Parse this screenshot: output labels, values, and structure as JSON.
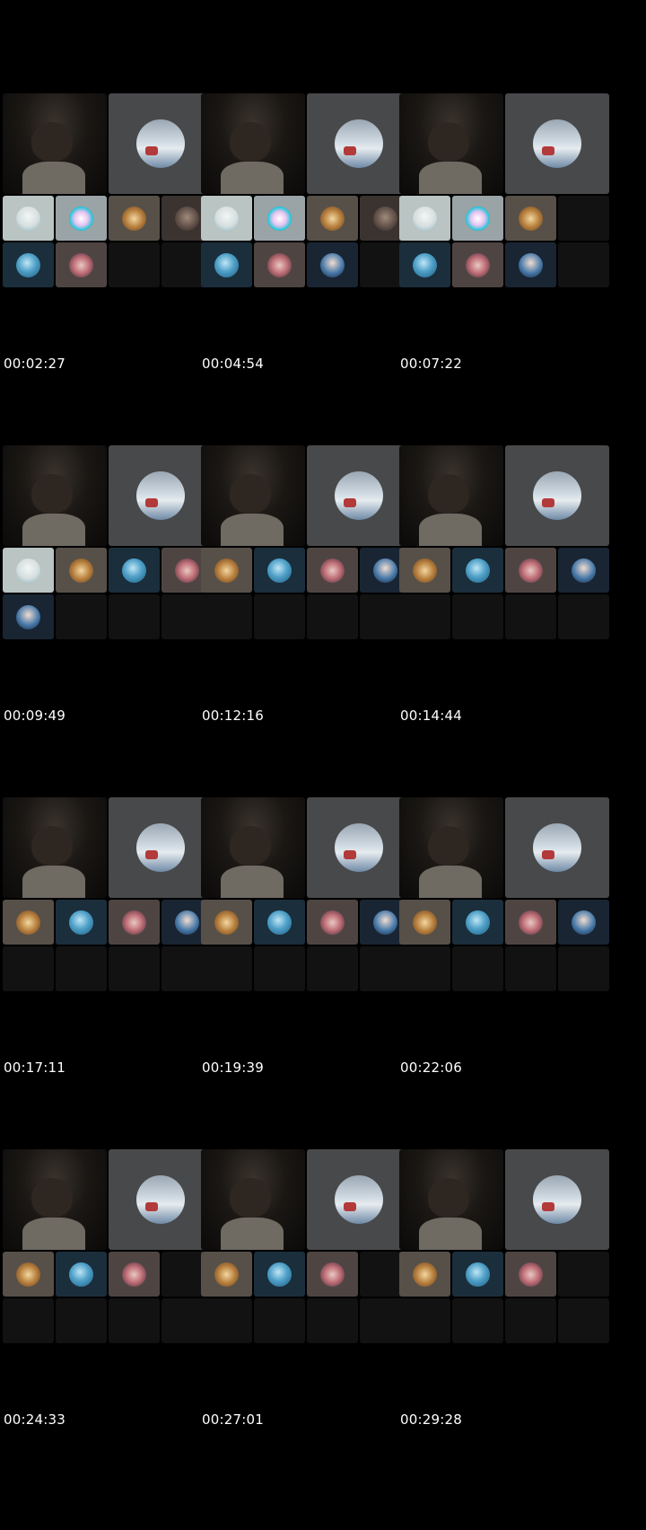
{
  "frames": [
    {
      "timestamp": "00:02:27",
      "tiles": [
        "cyan",
        "neon",
        "gold",
        "dark",
        "blue",
        "pink",
        "empty",
        "empty"
      ]
    },
    {
      "timestamp": "00:04:54",
      "tiles": [
        "cyan",
        "neon",
        "gold",
        "dark",
        "blue",
        "pink",
        "girl",
        "empty"
      ]
    },
    {
      "timestamp": "00:07:22",
      "tiles": [
        "cyan",
        "neon",
        "gold",
        "empty",
        "blue",
        "pink",
        "girl",
        "empty"
      ]
    },
    {
      "timestamp": "00:09:49",
      "tiles": [
        "cyan",
        "gold",
        "blue",
        "pink",
        "girl",
        "empty",
        "empty",
        "empty"
      ]
    },
    {
      "timestamp": "00:12:16",
      "tiles": [
        "gold",
        "blue",
        "pink",
        "girl",
        "empty",
        "empty",
        "empty",
        "empty"
      ]
    },
    {
      "timestamp": "00:14:44",
      "tiles": [
        "gold",
        "blue",
        "pink",
        "girl",
        "empty",
        "empty",
        "empty",
        "empty"
      ]
    },
    {
      "timestamp": "00:17:11",
      "tiles": [
        "gold",
        "blue",
        "pink",
        "girl",
        "empty",
        "empty",
        "empty",
        "empty"
      ]
    },
    {
      "timestamp": "00:19:39",
      "tiles": [
        "gold",
        "blue",
        "pink",
        "girl",
        "empty",
        "empty",
        "empty",
        "empty"
      ]
    },
    {
      "timestamp": "00:22:06",
      "tiles": [
        "gold",
        "blue",
        "pink",
        "girl",
        "empty",
        "empty",
        "empty",
        "empty"
      ]
    },
    {
      "timestamp": "00:24:33",
      "tiles": [
        "gold",
        "blue",
        "pink",
        "empty",
        "empty",
        "empty",
        "empty",
        "empty"
      ]
    },
    {
      "timestamp": "00:27:01",
      "tiles": [
        "gold",
        "blue",
        "pink",
        "empty",
        "empty",
        "empty",
        "empty",
        "empty"
      ]
    },
    {
      "timestamp": "00:29:28",
      "tiles": [
        "gold",
        "blue",
        "pink",
        "empty",
        "empty",
        "empty",
        "empty",
        "empty"
      ]
    }
  ],
  "tile_icons": {
    "cyan": "participant-avatar-icon",
    "neon": "participant-avatar-icon",
    "gold": "participant-avatar-icon",
    "dark": "participant-avatar-icon",
    "blue": "participant-avatar-icon",
    "pink": "participant-avatar-icon",
    "girl": "participant-avatar-icon"
  },
  "colors": {
    "background": "#000000",
    "timestamp_text": "#ffffff",
    "featured_tile": "#48494b",
    "empty_tile": "#121212"
  }
}
